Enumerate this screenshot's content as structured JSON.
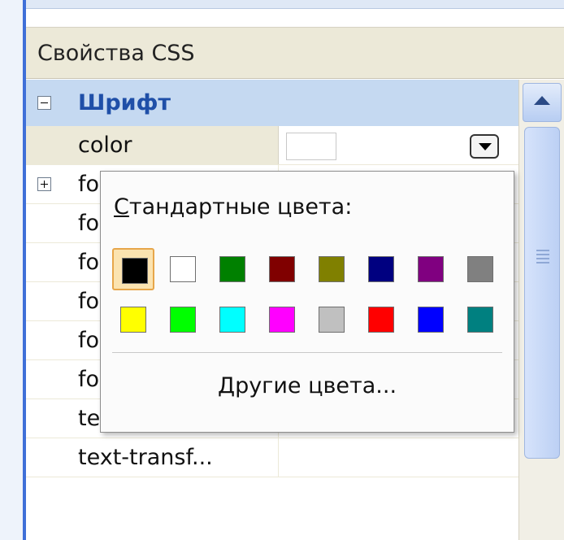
{
  "panel": {
    "title": "Свойства CSS"
  },
  "category": {
    "label": "Шрифт"
  },
  "properties": [
    {
      "name": "color",
      "value": ""
    },
    {
      "name": "fo",
      "value": ""
    },
    {
      "name": "fo",
      "value": ""
    },
    {
      "name": "fo",
      "value": ""
    },
    {
      "name": "fo",
      "value": ""
    },
    {
      "name": "fo",
      "value": ""
    },
    {
      "name": "font-weight",
      "value": ""
    },
    {
      "name": "text-decora...",
      "value": ""
    },
    {
      "name": "text-transf...",
      "value": ""
    }
  ],
  "color_picker": {
    "title_mnemonic": "С",
    "title_rest": "тандартные цвета:",
    "more_colors_label": "Другие цвета...",
    "selected_index": 0,
    "swatches": [
      "#000000",
      "#ffffff",
      "#008000",
      "#800000",
      "#808000",
      "#000080",
      "#800080",
      "#808080",
      "#ffff00",
      "#00ff00",
      "#00ffff",
      "#ff00ff",
      "#c0c0c0",
      "#ff0000",
      "#0000ff",
      "#008080"
    ]
  },
  "colors": {
    "category_bg": "#c5d9f1",
    "category_text": "#1f4fa8",
    "header_bg": "#ece9d8",
    "accent": "#3f6fd8"
  }
}
